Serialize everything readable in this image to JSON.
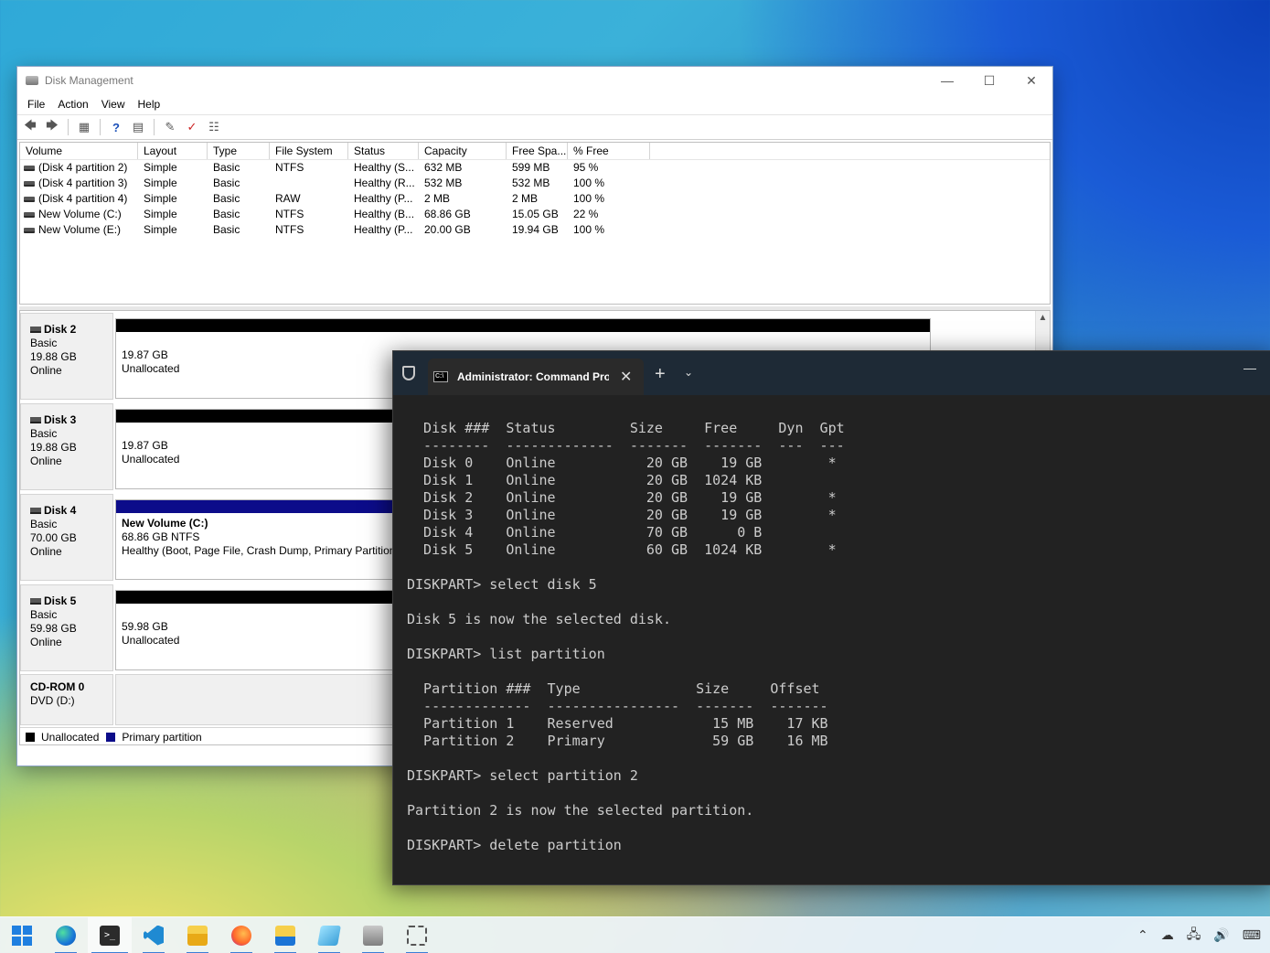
{
  "disk_mgmt": {
    "title": "Disk Management",
    "menu": [
      "File",
      "Action",
      "View",
      "Help"
    ],
    "columns": [
      "Volume",
      "Layout",
      "Type",
      "File System",
      "Status",
      "Capacity",
      "Free Spa...",
      "% Free"
    ],
    "volumes": [
      {
        "volume": "(Disk 4 partition 2)",
        "layout": "Simple",
        "type": "Basic",
        "fs": "NTFS",
        "status": "Healthy (S...",
        "capacity": "632 MB",
        "free": "599 MB",
        "pct": "95 %"
      },
      {
        "volume": "(Disk 4 partition 3)",
        "layout": "Simple",
        "type": "Basic",
        "fs": "",
        "status": "Healthy (R...",
        "capacity": "532 MB",
        "free": "532 MB",
        "pct": "100 %"
      },
      {
        "volume": "(Disk 4 partition 4)",
        "layout": "Simple",
        "type": "Basic",
        "fs": "RAW",
        "status": "Healthy (P...",
        "capacity": "2 MB",
        "free": "2 MB",
        "pct": "100 %"
      },
      {
        "volume": "New Volume (C:)",
        "layout": "Simple",
        "type": "Basic",
        "fs": "NTFS",
        "status": "Healthy (B...",
        "capacity": "68.86 GB",
        "free": "15.05 GB",
        "pct": "22 %"
      },
      {
        "volume": "New Volume (E:)",
        "layout": "Simple",
        "type": "Basic",
        "fs": "NTFS",
        "status": "Healthy (P...",
        "capacity": "20.00 GB",
        "free": "19.94 GB",
        "pct": "100 %"
      }
    ],
    "disks": [
      {
        "name": "Disk 2",
        "kind": "Basic",
        "size": "19.88 GB",
        "state": "Online",
        "part_line1": "19.87 GB",
        "part_line2": "Unallocated",
        "part_line3": ""
      },
      {
        "name": "Disk 3",
        "kind": "Basic",
        "size": "19.88 GB",
        "state": "Online",
        "part_line1": "19.87 GB",
        "part_line2": "Unallocated",
        "part_line3": ""
      },
      {
        "name": "Disk 4",
        "kind": "Basic",
        "size": "70.00 GB",
        "state": "Online",
        "part_title": "New Volume  (C:)",
        "part_line1": "68.86 GB NTFS",
        "part_line2": "Healthy (Boot, Page File, Crash Dump, Primary Partition)"
      },
      {
        "name": "Disk 5",
        "kind": "Basic",
        "size": "59.98 GB",
        "state": "Online",
        "part_line1": "59.98 GB",
        "part_line2": "Unallocated",
        "part_line3": ""
      }
    ],
    "cdrom": {
      "name": "CD-ROM 0",
      "sub": "DVD (D:)"
    },
    "legend": {
      "unallocated": "Unallocated",
      "primary": "Primary partition"
    }
  },
  "terminal": {
    "tab_title": "Administrator: Command Prompt",
    "lines": [
      "  Disk ###  Status         Size     Free     Dyn  Gpt",
      "  --------  -------------  -------  -------  ---  ---",
      "  Disk 0    Online           20 GB    19 GB        *",
      "  Disk 1    Online           20 GB  1024 KB",
      "  Disk 2    Online           20 GB    19 GB        *",
      "  Disk 3    Online           20 GB    19 GB        *",
      "  Disk 4    Online           70 GB      0 B",
      "  Disk 5    Online           60 GB  1024 KB        *",
      "",
      "DISKPART> select disk 5",
      "",
      "Disk 5 is now the selected disk.",
      "",
      "DISKPART> list partition",
      "",
      "  Partition ###  Type              Size     Offset",
      "  -------------  ----------------  -------  -------",
      "  Partition 1    Reserved            15 MB    17 KB",
      "  Partition 2    Primary             59 GB    16 MB",
      "",
      "DISKPART> select partition 2",
      "",
      "Partition 2 is now the selected partition.",
      "",
      "DISKPART> delete partition"
    ]
  },
  "colors": {
    "unallocated": "#000000",
    "primary_partition": "#0c0c8a",
    "terminal_bg": "#222222"
  },
  "taskbar": {
    "apps": [
      "start-icon",
      "edge-icon",
      "terminal-icon",
      "vscode-icon",
      "file-explorer-icon",
      "firefox-icon",
      "onedrive-folder-icon",
      "notepad-icon",
      "package-icon",
      "snipping-tool-icon"
    ]
  }
}
